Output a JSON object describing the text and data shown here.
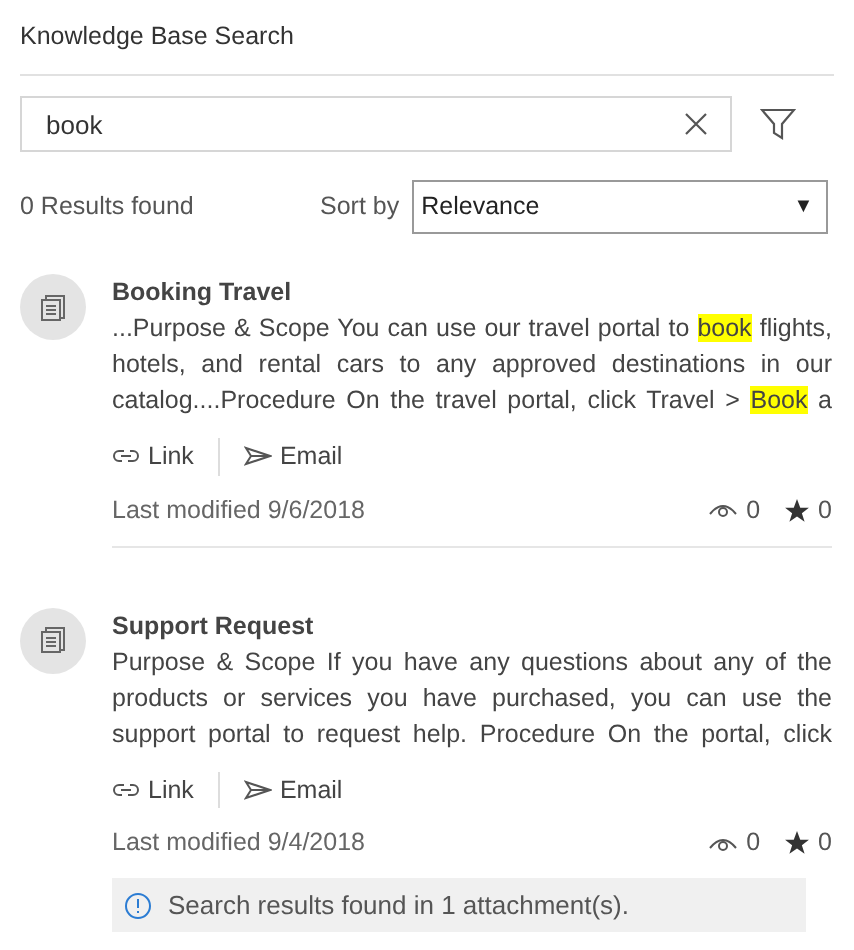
{
  "header": {
    "title": "Knowledge Base Search"
  },
  "search": {
    "value": "book"
  },
  "results_count": "0 Results found",
  "sort": {
    "label": "Sort by",
    "value": "Relevance",
    "arrow": "▼"
  },
  "articles": [
    {
      "title": "Booking Travel",
      "snippet_lines": [
        [
          {
            "text": "...Purpose & Scope You can use our travel portal to ",
            "highlight": false
          },
          {
            "text": "book",
            "highlight": true
          },
          {
            "text": " flights,",
            "highlight": false
          }
        ],
        [
          {
            "text": "hotels, and rental cars to any approved destinations in our",
            "highlight": false
          }
        ],
        [
          {
            "text": "catalog....Procedure On the travel portal, click Travel > ",
            "highlight": false
          },
          {
            "text": "Book",
            "highlight": true
          },
          {
            "text": " a",
            "highlight": false
          }
        ]
      ],
      "actions": [
        "Link",
        "Email"
      ],
      "modified": "Last modified 9/6/2018",
      "views": "0",
      "rating": "0"
    },
    {
      "title": "Support Request",
      "snippet_lines": [
        [
          {
            "text": "Purpose & Scope If you have any questions about any of the",
            "highlight": false
          }
        ],
        [
          {
            "text": "products or services you have purchased, you can use the",
            "highlight": false
          }
        ],
        [
          {
            "text": "support portal to request help. Procedure On the portal, click",
            "highlight": false
          }
        ]
      ],
      "actions": [
        "Link",
        "Email"
      ],
      "modified": "Last modified 9/4/2018",
      "views": "0",
      "rating": "0",
      "notice": "Search results found in 1 attachment(s)."
    }
  ]
}
